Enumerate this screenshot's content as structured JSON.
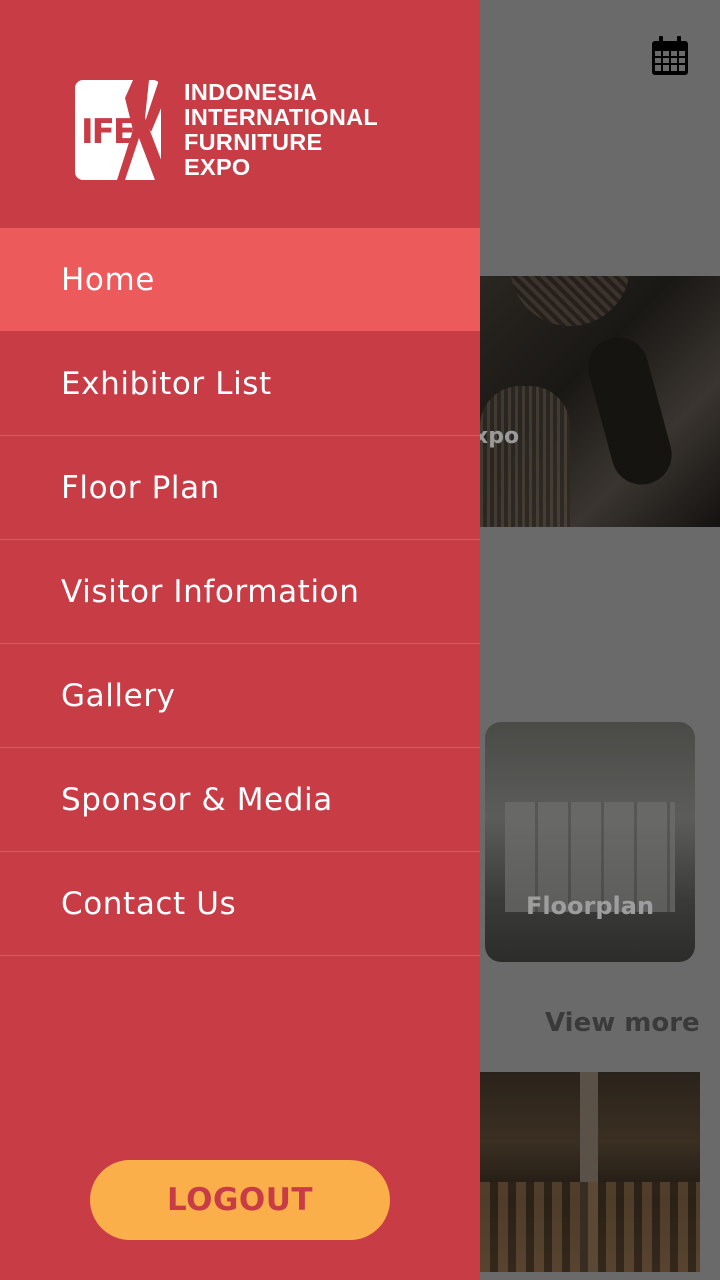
{
  "drawer": {
    "logo": {
      "mark": "IFE",
      "lines": [
        "INDONESIA",
        "INTERNATIONAL",
        "FURNITURE",
        "EXPO"
      ]
    },
    "menu": [
      {
        "label": "Home",
        "active": true
      },
      {
        "label": "Exhibitor List",
        "active": false
      },
      {
        "label": "Floor Plan",
        "active": false
      },
      {
        "label": "Visitor Information",
        "active": false
      },
      {
        "label": "Gallery",
        "active": false
      },
      {
        "label": "Sponsor & Media",
        "active": false
      },
      {
        "label": "Contact Us",
        "active": false
      }
    ],
    "logout_label": "LOGOUT"
  },
  "background": {
    "hero_caption_fragment": "xpo",
    "floorplan_label": "Floorplan",
    "view_more_label": "View more",
    "calendar_icon": "calendar-icon"
  },
  "colors": {
    "drawer": "#c83c46",
    "active_item": "#ec5a5b",
    "logout_button": "#fbaf4b",
    "logout_text": "#c83c46",
    "scrim": "#6a6a6a"
  }
}
